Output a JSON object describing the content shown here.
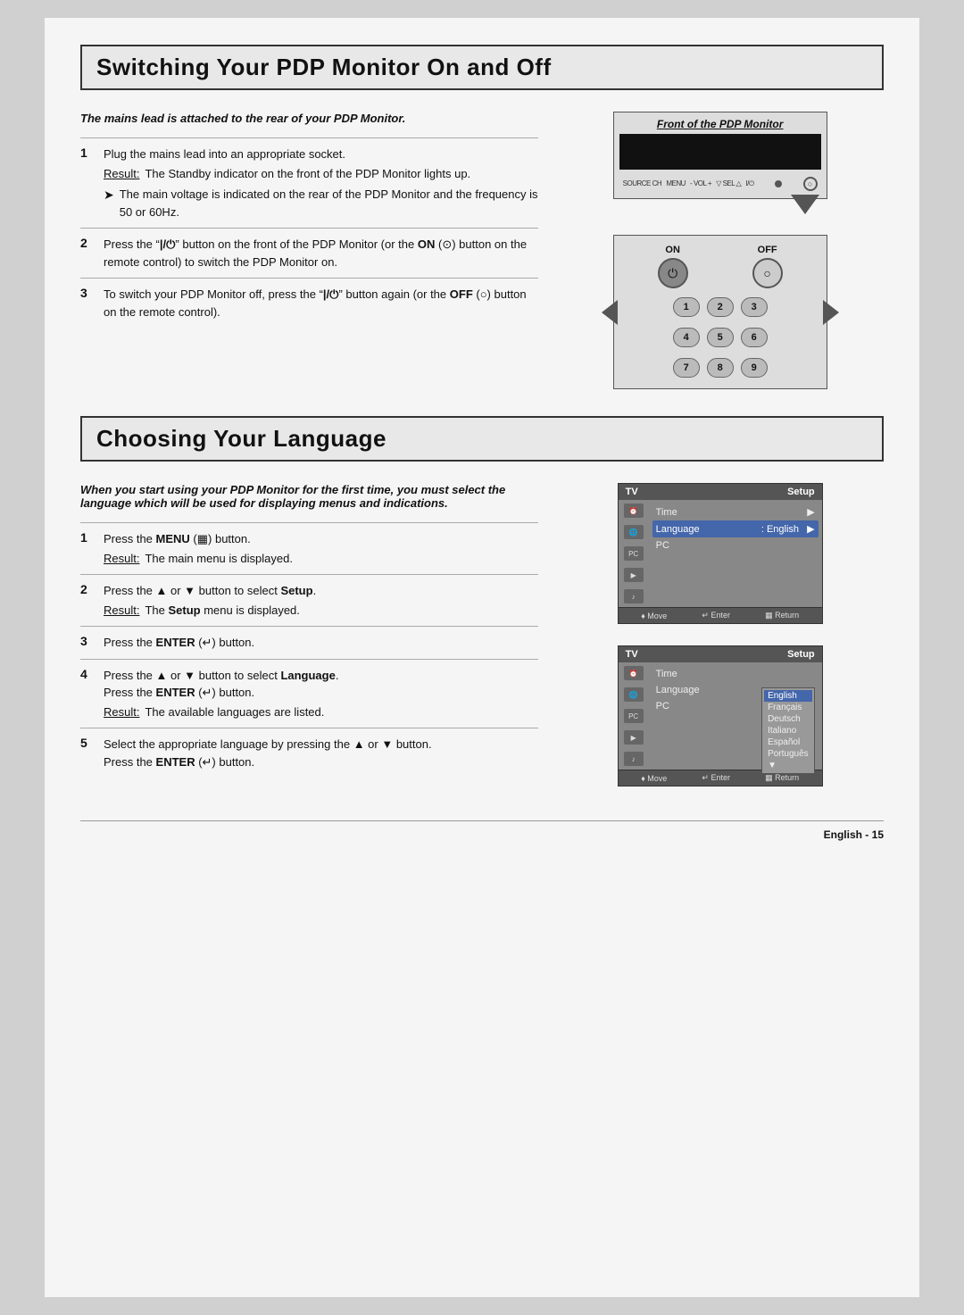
{
  "section1": {
    "title": "Switching Your PDP Monitor On and Off",
    "intro": "The mains lead is attached to the rear of your PDP Monitor.",
    "steps": [
      {
        "num": "1",
        "text": "Plug the mains lead into an appropriate socket.",
        "result": "The Standby indicator on the front of the PDP Monitor lights up.",
        "note": "The main voltage is indicated on the rear of the PDP Monitor and the frequency is 50 or 60Hz."
      },
      {
        "num": "2",
        "text_before": "Press the “│/⏻” button on the front of the PDP Monitor (or the ",
        "bold_word": "ON",
        "text_after": " (⊙) button on the remote control) to switch the PDP Monitor on."
      },
      {
        "num": "3",
        "text_before": "To switch your PDP Monitor off, press the “│/⏻” button again (or the ",
        "bold_word": "OFF",
        "text_after": " (○) button on the remote control)."
      }
    ],
    "monitor_diagram": {
      "title": "Front of the PDP Monitor",
      "controls_text": "SOURCE CH   MENU   - VOL +   ▽ SEL △   I/⏻"
    },
    "remote_labels": {
      "on": "ON",
      "off": "OFF"
    },
    "remote_keys": [
      [
        "1",
        "2",
        "3"
      ],
      [
        "4",
        "5",
        "6"
      ],
      [
        "7",
        "8",
        "9"
      ]
    ]
  },
  "section2": {
    "title": "Choosing Your Language",
    "intro": "When you start using your PDP Monitor for the first time, you must select the language which will be used for displaying menus and indications.",
    "steps": [
      {
        "num": "1",
        "text": "Press the MENU (☐) button.",
        "result": "The main menu is displayed."
      },
      {
        "num": "2",
        "text": "Press the ▲ or ▼ button to select Setup.",
        "result": "The Setup menu is displayed."
      },
      {
        "num": "3",
        "text": "Press the ENTER (↵) button."
      },
      {
        "num": "4",
        "text": "Press the ▲ or ▼ button to select Language.",
        "text2": "Press the ENTER (↵) button.",
        "result": "The available languages are listed."
      },
      {
        "num": "5",
        "text": "Select the appropriate language by pressing the ▲ or ▼ button.",
        "text2": "Press the ENTER (↵) button."
      }
    ],
    "tv_menu1": {
      "header_left": "TV",
      "header_right": "Setup",
      "rows": [
        {
          "label": "Time",
          "value": "",
          "arrow": "►",
          "highlighted": false
        },
        {
          "label": "Language",
          "value": ": English",
          "arrow": "►",
          "highlighted": true
        },
        {
          "label": "PC",
          "value": "",
          "arrow": "",
          "highlighted": false
        }
      ],
      "footer": [
        "♥ Move",
        "↵ Enter",
        "☐ Return"
      ]
    },
    "tv_menu2": {
      "header_left": "TV",
      "header_right": "Setup",
      "rows_left": [
        "Time",
        "Language",
        "PC"
      ],
      "languages": [
        "English",
        "Français",
        "Deutsch",
        "Italiano",
        "Español",
        "Português",
        "▼"
      ],
      "active_lang": "English",
      "footer": [
        "♥ Move",
        "↵ Enter",
        "☐ Return"
      ]
    }
  },
  "footer": {
    "text": "English - 15"
  }
}
